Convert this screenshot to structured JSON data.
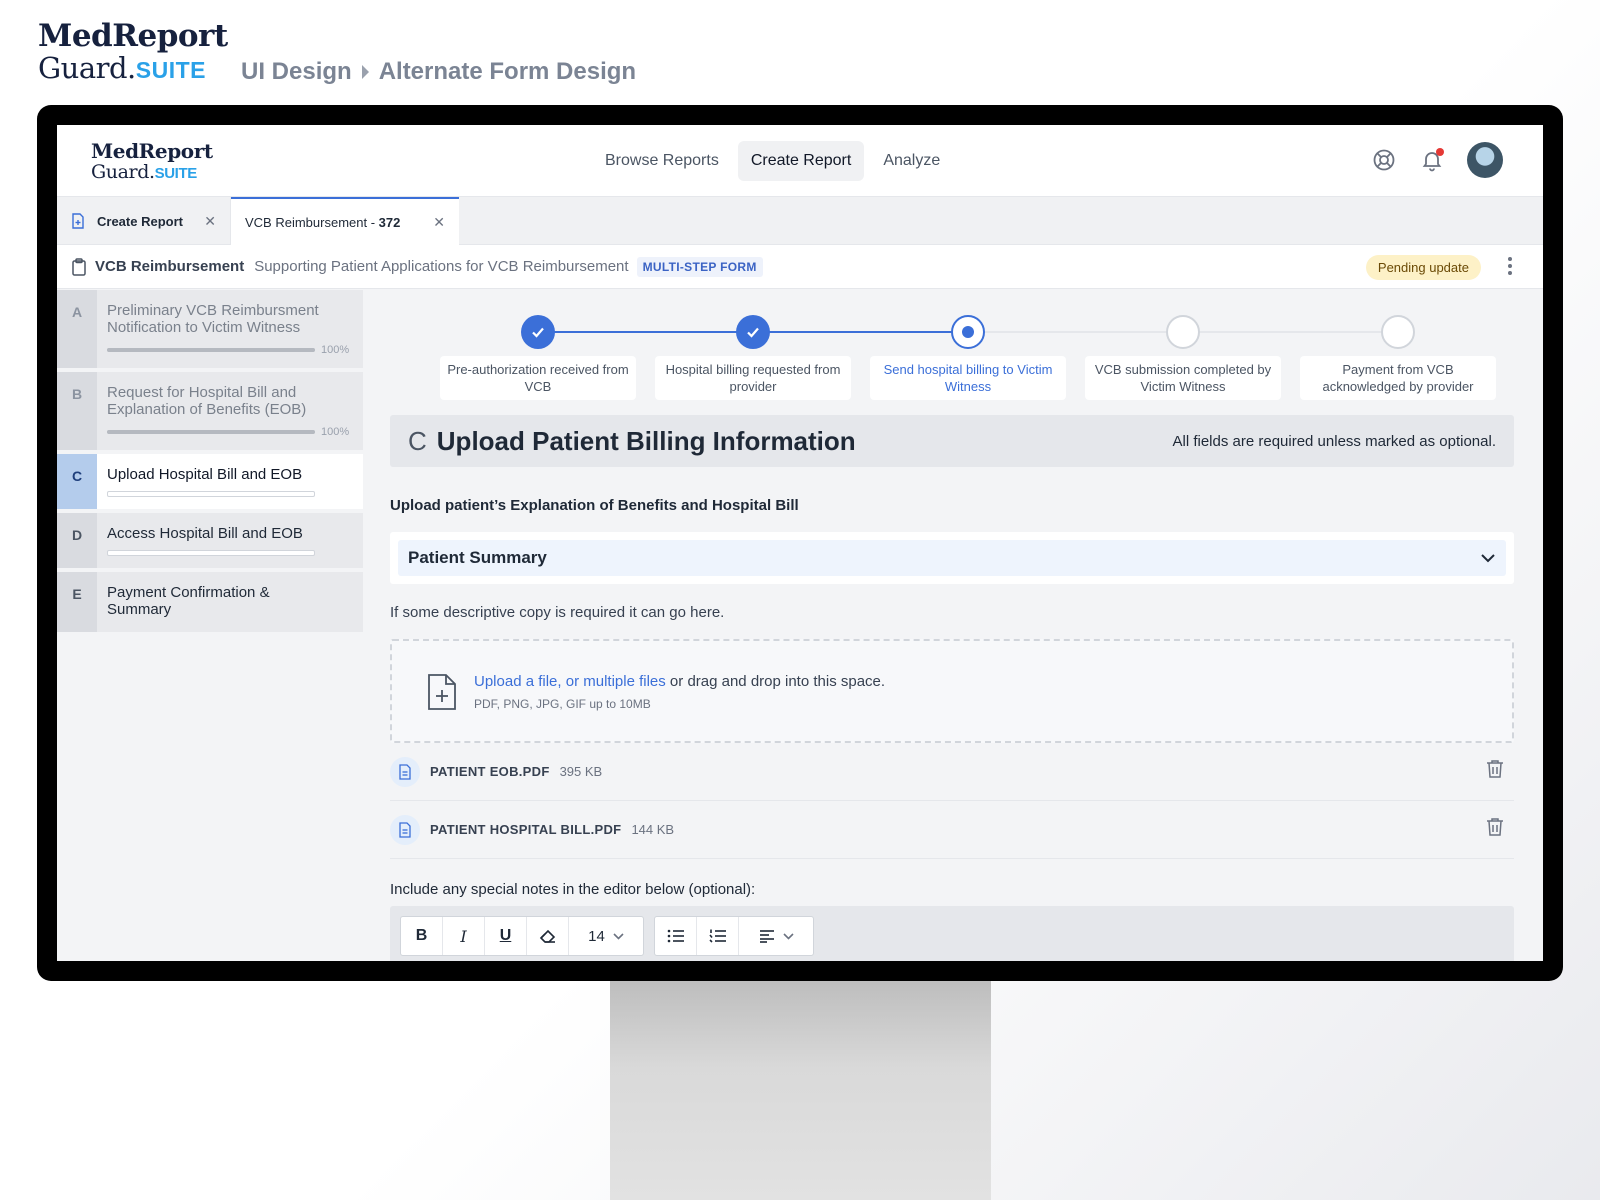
{
  "brand": {
    "name_line1": "MedReport",
    "name_line2": "Guard.",
    "suite": "SUITE"
  },
  "top_breadcrumb": [
    "UI Design",
    "Alternate Form Design"
  ],
  "nav": {
    "links": [
      "Browse Reports",
      "Create Report",
      "Analyze"
    ],
    "active": "Create Report",
    "icons": [
      "help-lifebuoy-icon",
      "bell-icon",
      "avatar"
    ]
  },
  "tabs": {
    "first": {
      "label": "Create Report"
    },
    "active": {
      "label": "VCB Reimbursement - ",
      "number": "372"
    }
  },
  "form_header": {
    "title": "VCB Reimbursement",
    "subtitle": "Supporting Patient Applications for VCB Reimbursement",
    "chip": "MULTI-STEP FORM",
    "status": "Pending update"
  },
  "sidebar": [
    {
      "letter": "A",
      "label": "Preliminary VCB Reimbursment Notification to Victim Witness",
      "progress": 100,
      "progress_label": "100%",
      "state": "done"
    },
    {
      "letter": "B",
      "label": "Request for Hospital Bill and Explanation of Benefits (EOB)",
      "progress": 100,
      "progress_label": "100%",
      "state": "done"
    },
    {
      "letter": "C",
      "label": "Upload Hospital Bill and EOB",
      "progress": 0,
      "state": "current"
    },
    {
      "letter": "D",
      "label": "Access Hospital Bill and EOB",
      "progress": 0,
      "state": "future"
    },
    {
      "letter": "E",
      "label": "Payment Confirmation & Summary",
      "state": "future"
    }
  ],
  "stepper": [
    {
      "label": "Pre-authorization received from VCB",
      "state": "done"
    },
    {
      "label": "Hospital billing requested from provider",
      "state": "done"
    },
    {
      "label": "Send hospital billing to Victim Witness",
      "state": "current"
    },
    {
      "label": "VCB submission completed by Victim Witness",
      "state": "todo"
    },
    {
      "label": "Payment from VCB acknowledged by provider",
      "state": "todo"
    }
  ],
  "section": {
    "letter": "C",
    "title": "Upload Patient Billing Information",
    "required_note": "All fields are required unless marked as optional.",
    "upload_label": "Upload patient’s Explanation of Benefits and Hospital Bill",
    "dropdown": "Patient Summary",
    "description": "If some descriptive copy is required it can go here.",
    "dropzone_link": "Upload a file, or multiple files",
    "dropzone_text": " or drag and drop into this space.",
    "dropzone_hint": "PDF, PNG, JPG, GIF up to 10MB",
    "files": [
      {
        "name": "PATIENT EOB.PDF",
        "size": "395 KB"
      },
      {
        "name": "PATIENT HOSPITAL BILL.PDF",
        "size": "144 KB"
      }
    ],
    "notes_label": "Include any special notes in the editor below (optional):"
  },
  "editor": {
    "bold": "B",
    "italic": "I",
    "underline": "U",
    "font_size": "14",
    "icons": [
      "eraser-icon",
      "bullet-list-icon",
      "numbered-list-icon",
      "align-left-icon"
    ]
  },
  "colors": {
    "accent": "#3b6fd8",
    "brand_navy": "#16213e",
    "brand_suite": "#2aa1e8",
    "pending_bg": "#fdf1c7"
  }
}
